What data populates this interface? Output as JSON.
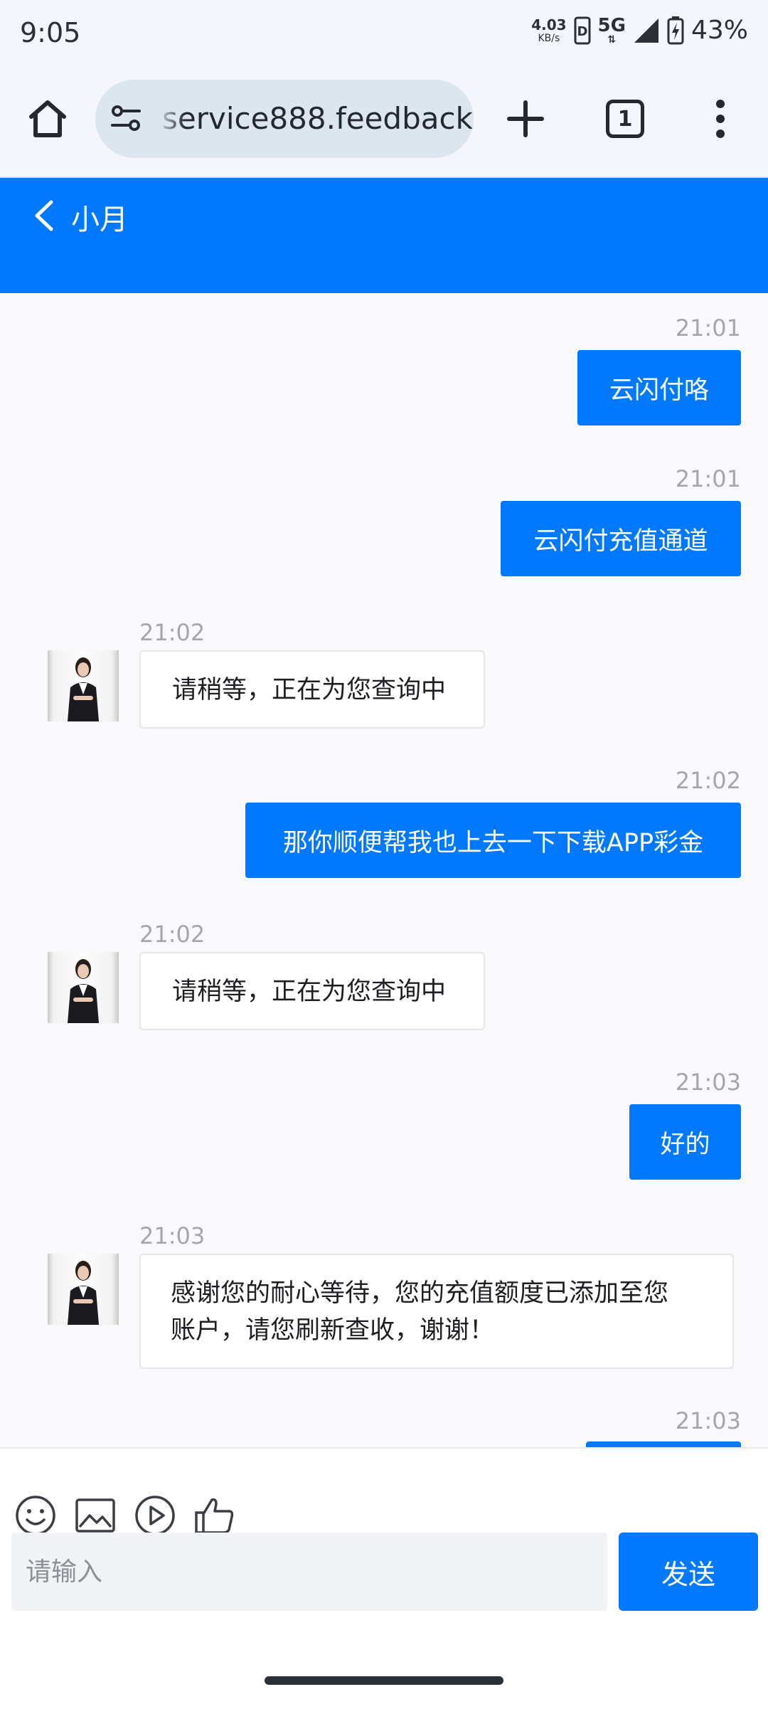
{
  "status_bar": {
    "time": "9:05",
    "net_speed_value": "4.03",
    "net_speed_unit": "KB/s",
    "network": "5G",
    "battery": "43%"
  },
  "browser": {
    "url": "service888.feedback",
    "tab_count": "1"
  },
  "header": {
    "title": "小月"
  },
  "messages": [
    {
      "direction": "out",
      "time": "21:01",
      "text": "云闪付咯"
    },
    {
      "direction": "out",
      "time": "21:01",
      "text": "云闪付充值通道"
    },
    {
      "direction": "in",
      "time": "21:02",
      "text": "请稍等，正在为您查询中"
    },
    {
      "direction": "out",
      "time": "21:02",
      "text": "那你顺便帮我也上去一下下载APP彩金"
    },
    {
      "direction": "in",
      "time": "21:02",
      "text": "请稍等，正在为您查询中"
    },
    {
      "direction": "out",
      "time": "21:03",
      "text": "好的"
    },
    {
      "direction": "in",
      "time": "21:03",
      "text_lines": [
        "感谢您的耐心等待，您的充值额度已添加至您",
        "账户，请您刷新查收，谢谢！"
      ]
    },
    {
      "direction": "out",
      "time": "21:03",
      "text": ""
    }
  ],
  "composer": {
    "placeholder": "请输入",
    "send_label": "发送"
  },
  "colors": {
    "accent": "#0079fe",
    "chat_background": "#f9f9fb",
    "timestamp": "#a3a7ad"
  },
  "icons": {
    "toolbar": [
      "home-icon",
      "site-settings-icon",
      "plus-icon",
      "tabs-icon",
      "more-vert-icon"
    ],
    "composer": [
      "emoji-icon",
      "image-icon",
      "video-icon",
      "thumbs-up-icon"
    ]
  }
}
